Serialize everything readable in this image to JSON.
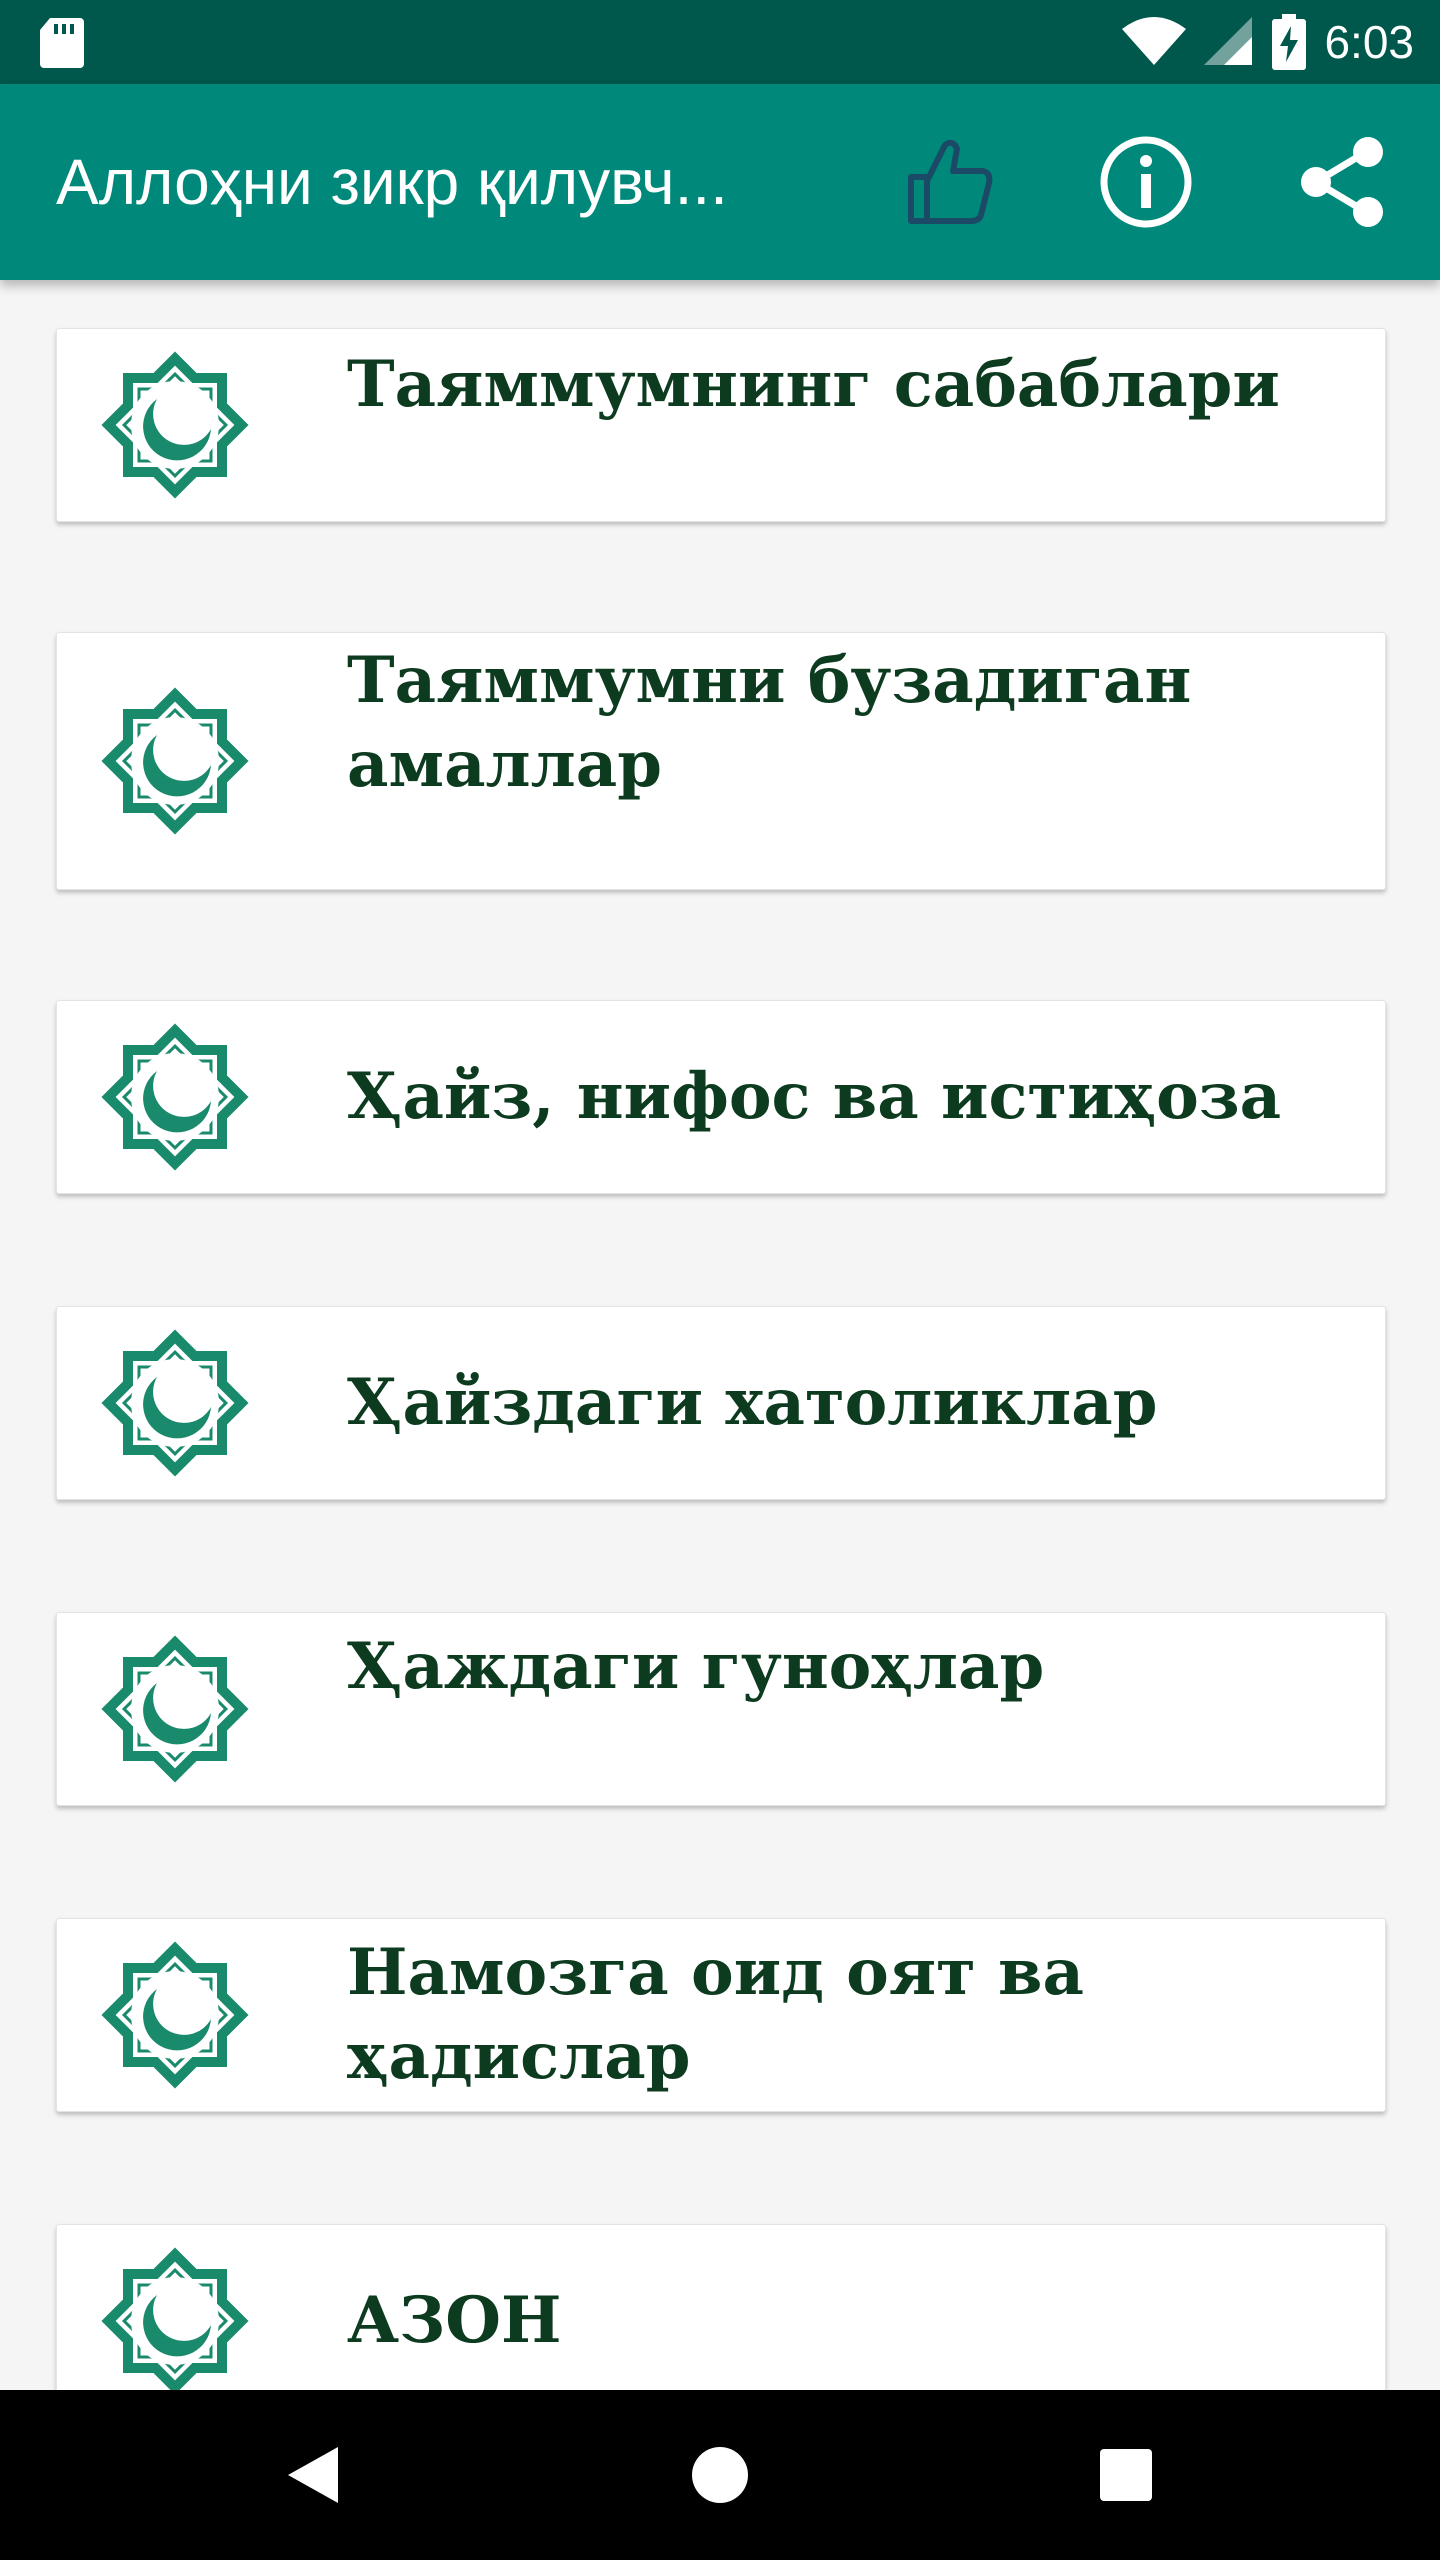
{
  "status_bar": {
    "time": "6:03",
    "icons": [
      "sd-card-icon",
      "wifi-icon",
      "signal-icon",
      "battery-charging-icon"
    ]
  },
  "app_bar": {
    "title": "Аллоҳни зикр қилувч...",
    "actions": [
      "thumbs-up-icon",
      "info-icon",
      "share-icon"
    ]
  },
  "list": {
    "items": [
      {
        "label": "Таяммумнинг сабаблари"
      },
      {
        "label": "Таяммумни бузадиган амаллар"
      },
      {
        "label": "Ҳайз, нифос ва истиҳоза"
      },
      {
        "label": "Ҳайздаги хатоликлар"
      },
      {
        "label": "Ҳаждаги гуноҳлар"
      },
      {
        "label": "Намозга оид оят ва ҳадислар"
      },
      {
        "label": "АЗОН"
      }
    ]
  },
  "nav_bar": {
    "buttons": [
      "back-icon",
      "home-icon",
      "recents-icon"
    ]
  },
  "colors": {
    "status_bar": "#00574c",
    "app_bar": "#00897b",
    "accent_icon": "#1a8a6c",
    "list_text": "#0d3b1f"
  }
}
